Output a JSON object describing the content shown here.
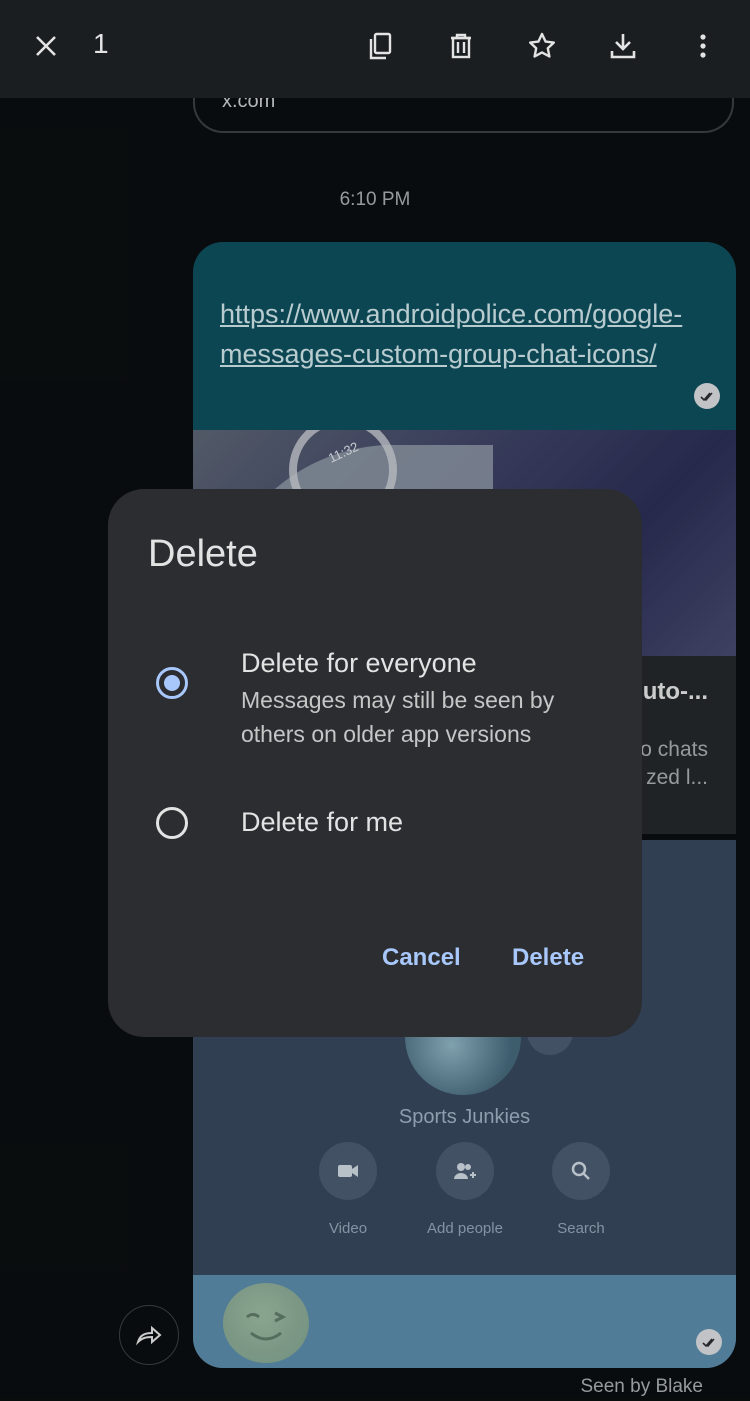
{
  "topbar": {
    "selected_count": "1"
  },
  "conversation": {
    "previous_message_text": "x.com",
    "timestamp": "6:10 PM",
    "link_bubble": {
      "url": "https://www.androidpolice.com/google-messages-custom-group-chat-icons/",
      "preview_title_fragment": "uto-...",
      "preview_desc_line1": "o chats",
      "preview_desc_line2": "zed l...",
      "image_clock_text": "11:32"
    },
    "screenshot_bubble": {
      "group_name": "Sports Junkies",
      "actions": [
        {
          "label": "Video",
          "icon": "video-icon"
        },
        {
          "label": "Add people",
          "icon": "add-people-icon"
        },
        {
          "label": "Search",
          "icon": "search-icon"
        }
      ]
    },
    "seen_status": "Seen by Blake"
  },
  "dialog": {
    "title": "Delete",
    "options": [
      {
        "title": "Delete for everyone",
        "subtitle": "Messages may still be seen by others on older app versions",
        "selected": true
      },
      {
        "title": "Delete for me",
        "selected": false
      }
    ],
    "cancel_label": "Cancel",
    "confirm_label": "Delete"
  },
  "colors": {
    "accent": "#a8c7fa",
    "dialog_bg": "#2b2d31",
    "app_bar_bg": "#1b1e20",
    "screen_bg": "#0b0e10"
  }
}
